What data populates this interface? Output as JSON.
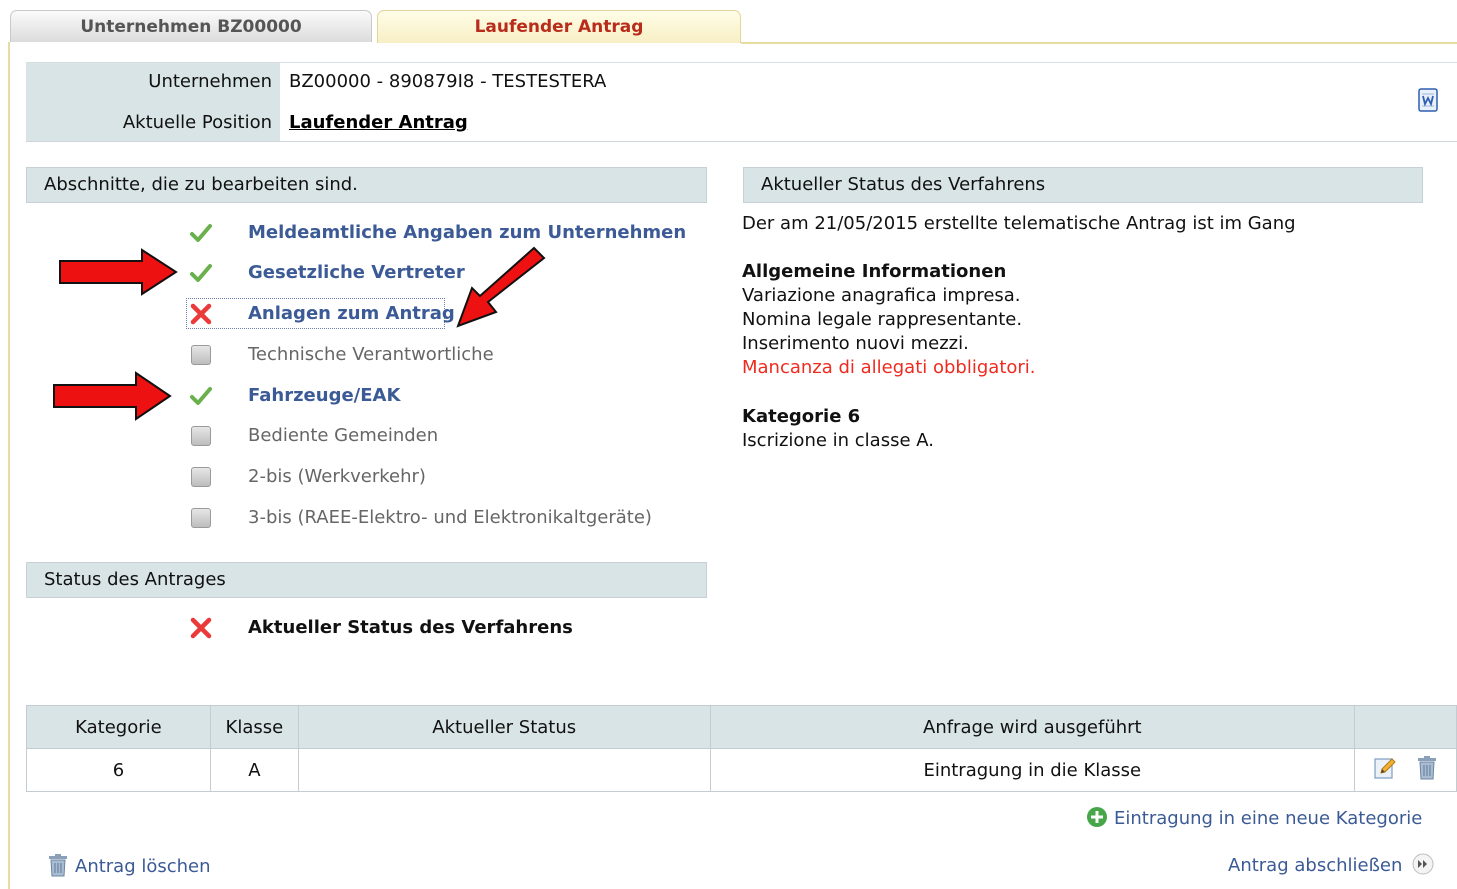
{
  "tabs": [
    {
      "label": "Unternehmen BZ00000"
    },
    {
      "label": "Laufender Antrag"
    }
  ],
  "info": {
    "company_label": "Unternehmen",
    "company_value": "BZ00000 - 890879I8 - TESTESTERA",
    "position_label": "Aktuelle Position",
    "position_value": "Laufender Antrag"
  },
  "sections": {
    "left_title": "Abschnitte, die zu bearbeiten sind.",
    "right_title": "Aktueller Status des Verfahrens",
    "antrag_title": "Status des Antrages"
  },
  "checklist": [
    {
      "label": "Meldeamtliche Angaben zum Unternehmen",
      "state": "done",
      "icon": "check-icon"
    },
    {
      "label": "Gesetzliche Vertreter",
      "state": "done",
      "icon": "check-icon"
    },
    {
      "label": "Anlagen zum Antrag",
      "state": "error",
      "icon": "cross-icon"
    },
    {
      "label": "Technische Verantwortliche",
      "state": "pending",
      "icon": "empty-checkbox-icon"
    },
    {
      "label": "Fahrzeuge/EAK",
      "state": "done",
      "icon": "check-icon"
    },
    {
      "label": "Bediente Gemeinden",
      "state": "pending",
      "icon": "empty-checkbox-icon"
    },
    {
      "label": "2-bis (Werkverkehr)",
      "state": "pending",
      "icon": "empty-checkbox-icon"
    },
    {
      "label": "3-bis (RAEE-Elektro- und Elektronikaltgeräte)",
      "state": "pending",
      "icon": "empty-checkbox-icon"
    }
  ],
  "antrag_status": {
    "label": "Aktueller Status des Verfahrens",
    "icon": "cross-icon"
  },
  "status_panel": {
    "intro": "Der am 21/05/2015 erstellte telematische Antrag ist im Gang",
    "general_heading": "Allgemeine Informationen",
    "general_lines": [
      "Variazione anagrafica impresa.",
      "Nomina legale rappresentante.",
      "Inserimento nuovi mezzi."
    ],
    "warning": "Mancanza di allegati obbligatori.",
    "category_heading": "Kategorie 6",
    "category_line": "Iscrizione in classe A."
  },
  "table": {
    "headers": [
      "Kategorie",
      "Klasse",
      "Aktueller Status",
      "Anfrage wird ausgeführt",
      ""
    ],
    "rows": [
      {
        "kategorie": "6",
        "klasse": "A",
        "status": "",
        "anfrage": "Eintragung in die Klasse"
      }
    ]
  },
  "links": {
    "new_category": "Eintragung in eine neue Kategorie",
    "delete": "Antrag löschen",
    "finish": "Antrag abschließen"
  },
  "colors": {
    "link_blue": "#3b5a96",
    "warning_red": "#ef2b1f",
    "active_tab_text": "#b92b1a",
    "header_bg": "#d8e4e6"
  }
}
